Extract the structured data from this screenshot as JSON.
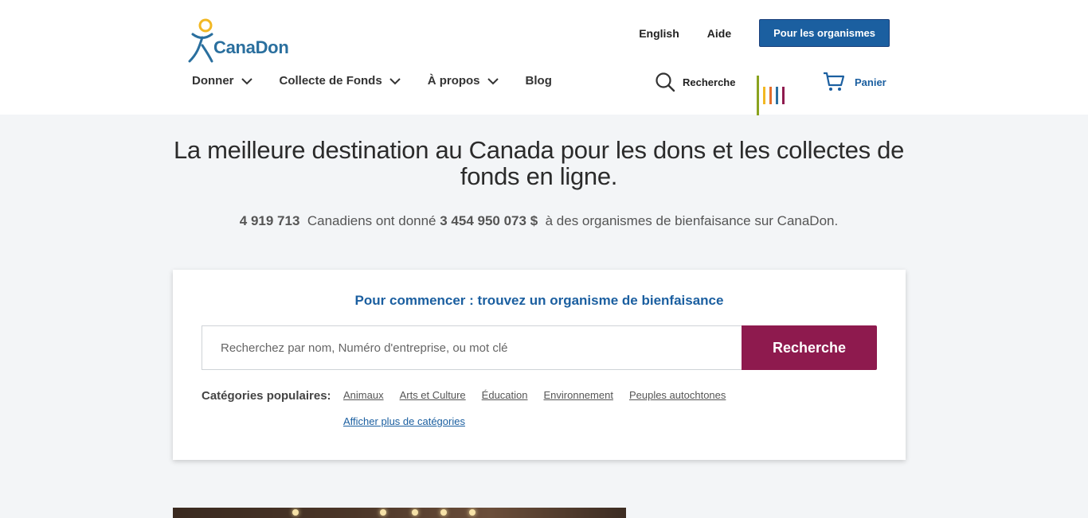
{
  "header": {
    "logo_text": "CanaDon",
    "top_links": {
      "english": "English",
      "help": "Aide"
    },
    "orgs_button": "Pour les organismes",
    "nav": {
      "give": "Donner",
      "fundraise": "Collecte de Fonds",
      "about": "À propos",
      "blog": "Blog"
    },
    "search_label": "Recherche",
    "cart_label": "Panier"
  },
  "hero": {
    "title": "La meilleure destination au Canada pour les dons et les collectes de fonds en ligne.",
    "donors_count": "4 919 713",
    "text_1": "Canadiens ont donné",
    "amount": "3 454 950 073 $",
    "text_2": "à des organismes de bienfaisance sur CanaDon."
  },
  "search_card": {
    "title": "Pour commencer : trouvez un organisme de bienfaisance",
    "placeholder": "Recherchez par nom, Numéro d'entreprise, ou mot clé",
    "button": "Recherche",
    "categories_label": "Catégories populaires:",
    "categories": [
      "Animaux",
      "Arts et Culture",
      "Éducation",
      "Environnement",
      "Peuples autochtones"
    ],
    "more_categories": "Afficher plus de catégories"
  },
  "colors": {
    "brand_blue": "#1b5fa0",
    "search_button": "#8e1a4e",
    "background": "#f3f5f7"
  }
}
